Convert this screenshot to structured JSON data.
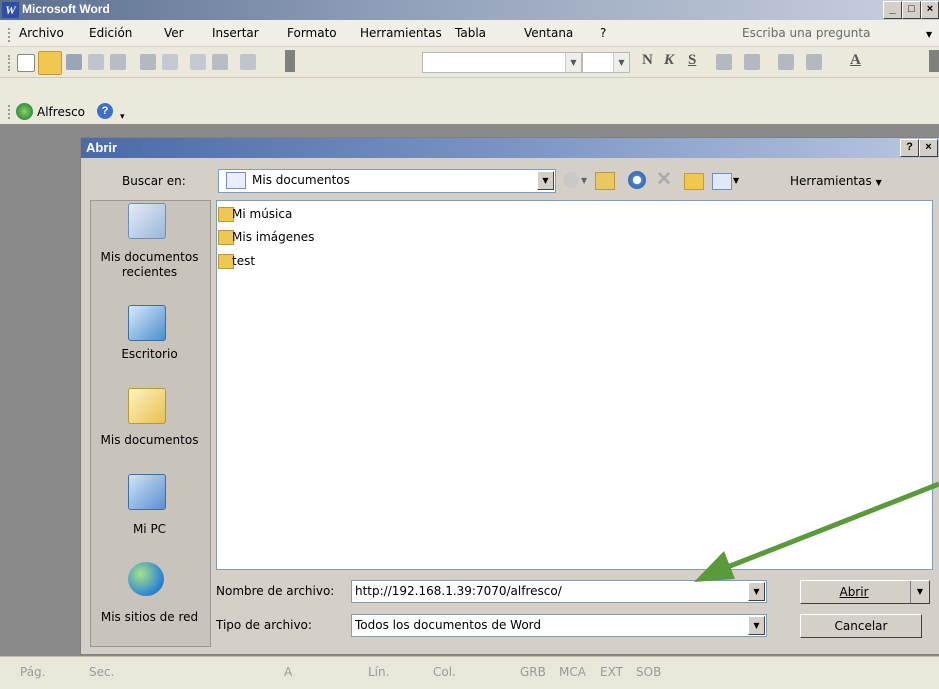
{
  "window": {
    "title": "Microsoft Word",
    "icon": "word-icon"
  },
  "menu": {
    "items": [
      "Archivo",
      "Edición",
      "Ver",
      "Insertar",
      "Formato",
      "Herramientas",
      "Tabla",
      "Ventana",
      "?"
    ],
    "ask_placeholder": "Escriba una pregunta"
  },
  "toolbar": {
    "format_bold": "N",
    "format_italic": "K",
    "format_underline": "S",
    "font_color": "A"
  },
  "alfresco_bar": {
    "label": "Alfresco"
  },
  "dialog": {
    "title": "Abrir",
    "help": "?",
    "close": "×",
    "look_in_label": "Buscar en:",
    "look_in_value": "Mis documentos",
    "tools_label": "Herramientas",
    "places": [
      "Mis documentos recientes",
      "Escritorio",
      "Mis documentos",
      "Mi PC",
      "Mis sitios de red"
    ],
    "files": [
      {
        "name": "Mi música",
        "icon": "music-folder-icon"
      },
      {
        "name": "Mis imágenes",
        "icon": "pictures-folder-icon"
      },
      {
        "name": "test",
        "icon": "folder-icon"
      }
    ],
    "filename_label": "Nombre de archivo:",
    "filename_value": "http://192.168.1.39:7070/alfresco/",
    "filetype_label": "Tipo de archivo:",
    "filetype_value": "Todos los documentos de Word",
    "open_button": "Abrir",
    "cancel_button": "Cancelar"
  },
  "status": [
    "Pág.",
    "Sec.",
    "A",
    "Lín.",
    "Col.",
    "GRB",
    "MCA",
    "EXT",
    "SOB"
  ],
  "annotation": {
    "arrow_color": "#5a9a3a"
  }
}
